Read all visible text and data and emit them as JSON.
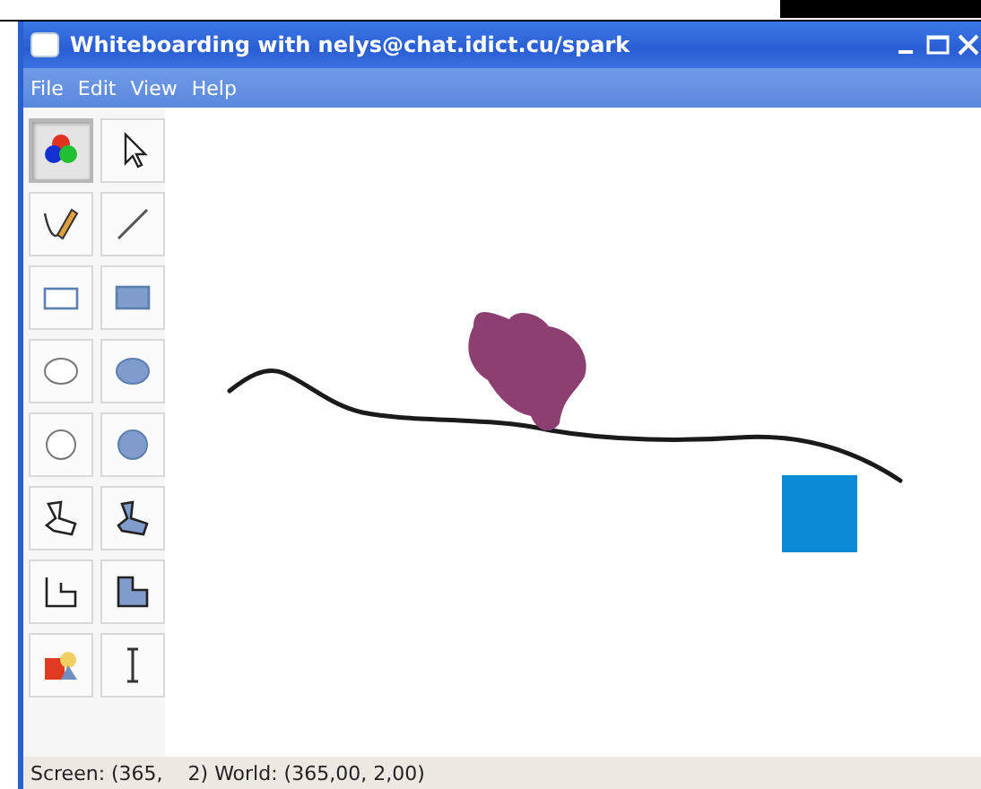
{
  "window": {
    "title": "Whiteboarding with nelys@chat.idict.cu/spark"
  },
  "menu": [
    "File",
    "Edit",
    "View",
    "Help"
  ],
  "tools": [
    {
      "kind": "color",
      "selected": true
    },
    {
      "kind": "pointer",
      "selected": false
    },
    {
      "kind": "pencil",
      "selected": false
    },
    {
      "kind": "line",
      "selected": false
    },
    {
      "kind": "rect",
      "selected": false
    },
    {
      "kind": "rect-filled",
      "selected": false
    },
    {
      "kind": "ellipse",
      "selected": false
    },
    {
      "kind": "ellipse-filled",
      "selected": false
    },
    {
      "kind": "circle",
      "selected": false
    },
    {
      "kind": "circle-filled",
      "selected": false
    },
    {
      "kind": "polygon",
      "selected": false
    },
    {
      "kind": "polygon-filled",
      "selected": false
    },
    {
      "kind": "polyline",
      "selected": false
    },
    {
      "kind": "polyline-filled",
      "selected": false
    },
    {
      "kind": "image",
      "selected": false
    },
    {
      "kind": "text",
      "selected": false
    }
  ],
  "canvas_shapes": [
    {
      "kind": "stroke",
      "color": "#1a1a1a"
    },
    {
      "kind": "blob",
      "color": "#8e3f72"
    },
    {
      "kind": "square",
      "color": "#0c8ad6"
    }
  ],
  "status_bar": "Screen: (365,    2) World: (365,00, 2,00)"
}
